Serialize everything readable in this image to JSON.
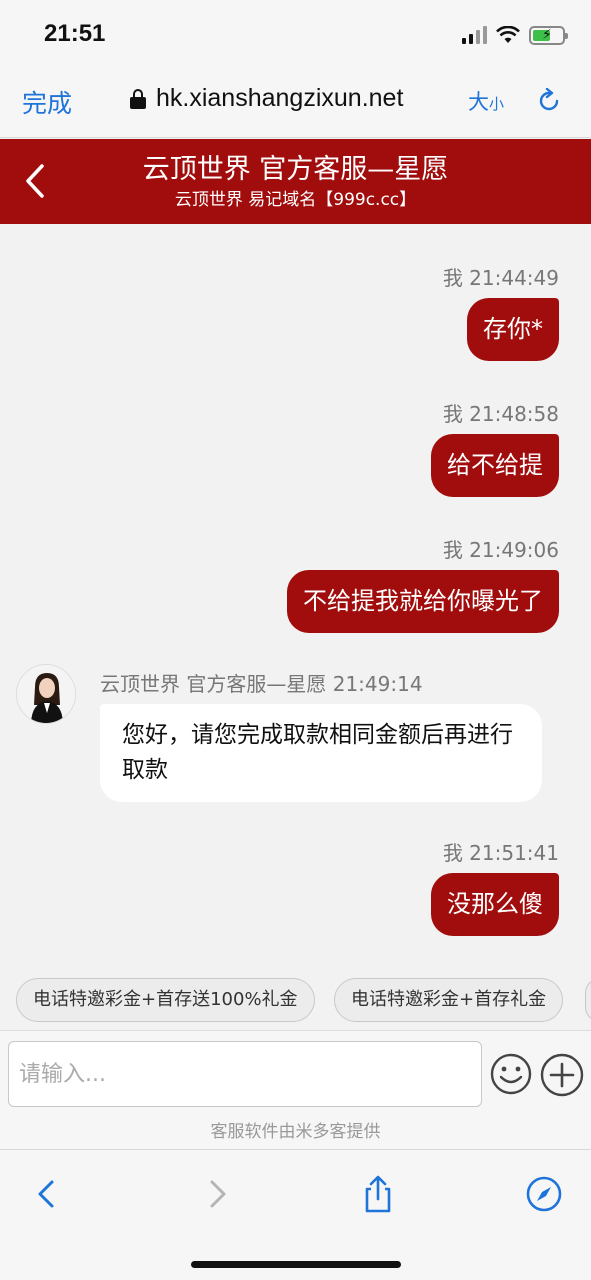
{
  "status_bar": {
    "time": "21:51"
  },
  "browser": {
    "done_label": "完成",
    "url": "hk.xianshangzixun.net",
    "text_size_big": "大",
    "text_size_small": "小"
  },
  "chat_header": {
    "title": "云顶世界 官方客服—星愿",
    "subtitle": "云顶世界 易记域名【999c.cc】"
  },
  "messages": [
    {
      "sender": "我",
      "time": "21:44:49",
      "text": "存你*"
    },
    {
      "sender": "我",
      "time": "21:48:58",
      "text": "给不给提"
    },
    {
      "sender": "我",
      "time": "21:49:06",
      "text": "不给提我就给你曝光了"
    },
    {
      "sender": "云顶世界 官方客服—星愿",
      "time": "21:49:14",
      "text": "您好，请您完成取款相同金额后再进行取款"
    },
    {
      "sender": "我",
      "time": "21:51:41",
      "text": "没那么傻"
    }
  ],
  "quick_replies": [
    "电话特邀彩金+首存送100%礼金",
    "电话特邀彩金+首存礼金"
  ],
  "input": {
    "placeholder": "请输入..."
  },
  "provider_note": "客服软件由米多客提供",
  "colors": {
    "brand_red": "#a10d0d",
    "ios_blue": "#1e74d8"
  }
}
